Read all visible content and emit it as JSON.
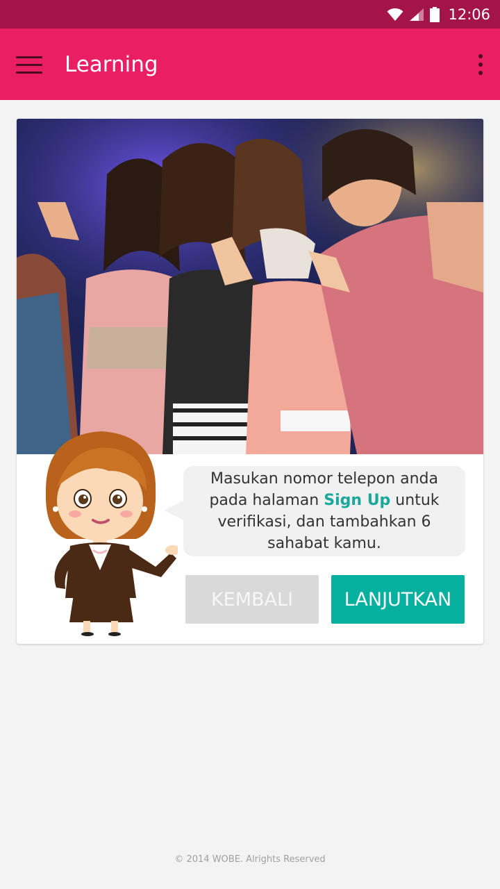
{
  "status_bar": {
    "time": "12:06",
    "icons": [
      "wifi-icon",
      "signal-icon",
      "battery-icon"
    ],
    "background": "#a3144a"
  },
  "app_bar": {
    "title": "Learning",
    "menu_icon": "hamburger-menu-icon",
    "overflow_icon": "more-vertical-icon",
    "background": "#ea1e63"
  },
  "card": {
    "photo": "group-of-women-at-party-photo",
    "mascot": "businesswoman-mascot-illustration",
    "message": {
      "before": "Masukan nomor telepon anda pada halaman ",
      "highlight": "Sign Up",
      "after": " untuk verifikasi, dan tambahkan 6 sahabat kamu."
    },
    "buttons": {
      "back_label": "KEMBALI",
      "next_label": "LANJUTKAN"
    },
    "accent": "#06b09e"
  },
  "footer": {
    "text": "© 2014 WOBE. Alrights Reserved"
  }
}
